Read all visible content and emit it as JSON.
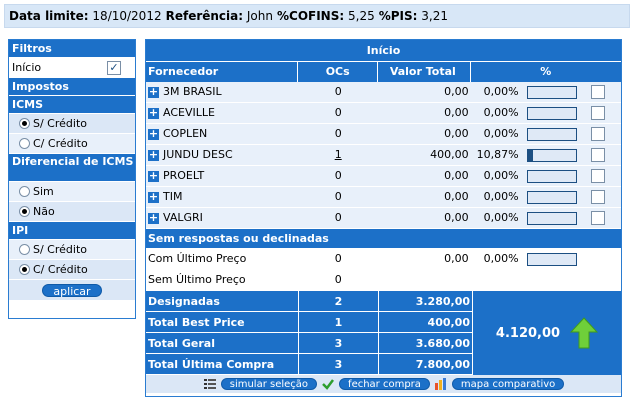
{
  "topbar": {
    "data_limite_label": "Data limite:",
    "data_limite_value": "18/10/2012",
    "referencia_label": "Referência:",
    "referencia_value": "John",
    "cofins_label": "%COFINS:",
    "cofins_value": "5,25",
    "pis_label": "%PIS:",
    "pis_value": "3,21"
  },
  "filters": {
    "title": "Filtros",
    "inicio_label": "Início",
    "inicio_checked": true,
    "impostos_title": "Impostos",
    "icms_title": "ICMS",
    "icms_options": [
      "S/ Crédito",
      "C/ Crédito"
    ],
    "icms_selected": 0,
    "diferencial_title": "Diferencial de ICMS",
    "diferencial_options": [
      "Sim",
      "Não"
    ],
    "diferencial_selected": 1,
    "ipi_title": "IPI",
    "ipi_options": [
      "S/ Crédito",
      "C/ Crédito"
    ],
    "ipi_selected": 1,
    "apply_label": "aplicar"
  },
  "main": {
    "title": "Início",
    "columns": [
      "Fornecedor",
      "OCs",
      "Valor Total",
      "%"
    ],
    "suppliers": [
      {
        "name": "3M BRASIL",
        "ocs": "0",
        "total": "0,00",
        "pct": "0,00%",
        "fill": 0.0
      },
      {
        "name": "ACEVILLE",
        "ocs": "0",
        "total": "0,00",
        "pct": "0,00%",
        "fill": 0.0
      },
      {
        "name": "COPLEN",
        "ocs": "0",
        "total": "0,00",
        "pct": "0,00%",
        "fill": 0.0
      },
      {
        "name": "JUNDU DESC",
        "ocs": "1",
        "total": "400,00",
        "pct": "10,87%",
        "fill": 0.1087
      },
      {
        "name": "PROELT",
        "ocs": "0",
        "total": "0,00",
        "pct": "0,00%",
        "fill": 0.0
      },
      {
        "name": "TIM",
        "ocs": "0",
        "total": "0,00",
        "pct": "0,00%",
        "fill": 0.0
      },
      {
        "name": "VALGRI",
        "ocs": "0",
        "total": "0,00",
        "pct": "0,00%",
        "fill": 0.0
      }
    ],
    "section_title": "Sem respostas ou declinadas",
    "com_ultimo": {
      "label": "Com Último Preço",
      "ocs": "0",
      "total": "0,00",
      "pct": "0,00%",
      "fill": 0.0
    },
    "sem_ultimo": {
      "label": "Sem Último Preço",
      "ocs": "0"
    },
    "totals": [
      {
        "label": "Designadas",
        "ocs": "2",
        "total": "3.280,00"
      },
      {
        "label": "Total Best Price",
        "ocs": "1",
        "total": "400,00"
      },
      {
        "label": "Total Geral",
        "ocs": "3",
        "total": "3.680,00"
      },
      {
        "label": "Total Última Compra",
        "ocs": "3",
        "total": "7.800,00"
      }
    ],
    "big_total": "4.120,00",
    "footer": {
      "simular_label": "simular seleção",
      "fechar_label": "fechar compra",
      "mapa_label": "mapa comparativo"
    }
  }
}
